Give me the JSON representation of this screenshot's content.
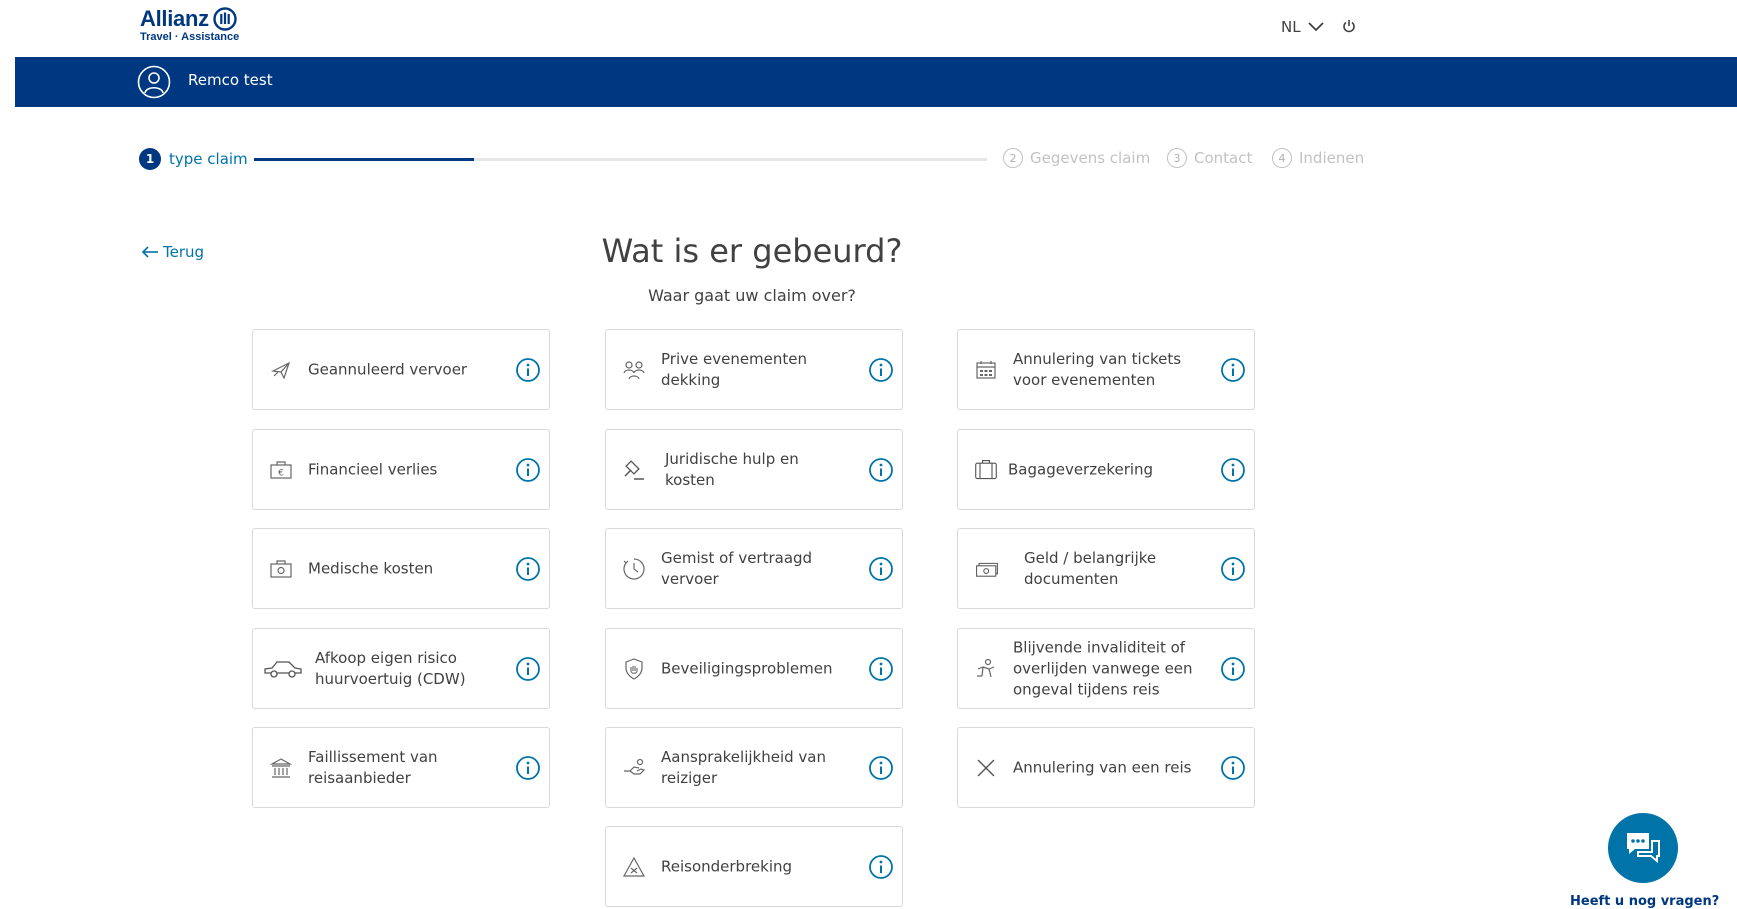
{
  "brand": {
    "name": "Allianz",
    "sub": "Travel · Assistance",
    "color": "#003781"
  },
  "header": {
    "language": "NL"
  },
  "user": {
    "name": "Remco test"
  },
  "stepper": {
    "steps": [
      {
        "num": "1",
        "label": "type claim"
      },
      {
        "num": "2",
        "label": "Gegevens claim"
      },
      {
        "num": "3",
        "label": "Contact"
      },
      {
        "num": "4",
        "label": "Indienen"
      }
    ]
  },
  "nav": {
    "back_label": "Terug"
  },
  "page": {
    "title": "Wat is er gebeurd?",
    "subtitle": "Waar gaat uw claim over?"
  },
  "cards": [
    {
      "label": "Geannuleerd vervoer",
      "icon": "plane-icon"
    },
    {
      "label": "Prive evenementen dekking",
      "icon": "people-icon"
    },
    {
      "label": "Annulering van tickets voor evenementen",
      "icon": "calendar-icon"
    },
    {
      "label": "Financieel verlies",
      "icon": "wallet-euro-icon"
    },
    {
      "label": "Juridische hulp en kosten",
      "icon": "gavel-icon"
    },
    {
      "label": "Bagageverzekering",
      "icon": "luggage-icon"
    },
    {
      "label": "Medische kosten",
      "icon": "medical-bag-icon"
    },
    {
      "label": "Gemist of vertraagd vervoer",
      "icon": "clock-icon"
    },
    {
      "label": "Geld / belangrijke documenten",
      "icon": "money-icon"
    },
    {
      "label": "Afkoop eigen risico huurvoertuig (CDW)",
      "icon": "car-icon"
    },
    {
      "label": "Beveiligingsproblemen",
      "icon": "shield-icon"
    },
    {
      "label": "Blijvende invaliditeit of overlijden vanwege een ongeval tijdens reis",
      "icon": "injury-icon"
    },
    {
      "label": "Faillissement van reisaanbieder",
      "icon": "bank-icon"
    },
    {
      "label": "Aansprakelijkheid van reiziger",
      "icon": "hand-icon"
    },
    {
      "label": "Annulering van een reis",
      "icon": "close-icon"
    },
    {
      "label": "Reisonderbreking",
      "icon": "warning-icon"
    }
  ],
  "chat": {
    "label": "Heeft u nog vragen?"
  },
  "colors": {
    "primary": "#003781",
    "accent": "#0073a8",
    "muted": "#c2c2c2"
  }
}
